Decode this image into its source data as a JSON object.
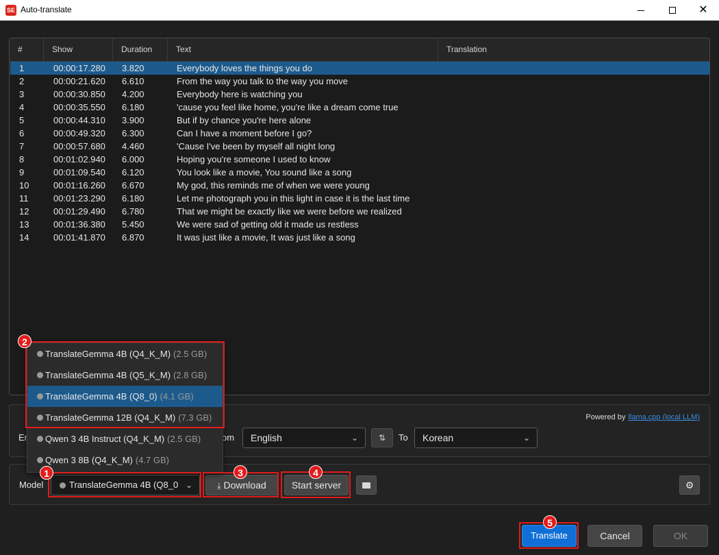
{
  "window": {
    "icon_text": "SE",
    "title": "Auto-translate",
    "minimize": "",
    "maximize": "",
    "close": "✕"
  },
  "grid": {
    "columns": [
      "#",
      "Show",
      "Duration",
      "Text",
      "Translation"
    ],
    "rows": [
      {
        "num": "1",
        "show": "00:00:17.280",
        "duration": "3.820",
        "text": "Everybody loves the things you do",
        "translation": ""
      },
      {
        "num": "2",
        "show": "00:00:21.620",
        "duration": "6.610",
        "text": "From the way you talk to the way you move",
        "translation": ""
      },
      {
        "num": "3",
        "show": "00:00:30.850",
        "duration": "4.200",
        "text": "Everybody here is watching you",
        "translation": ""
      },
      {
        "num": "4",
        "show": "00:00:35.550",
        "duration": "6.180",
        "text": "'cause you feel like home, you're like a dream come true",
        "translation": ""
      },
      {
        "num": "5",
        "show": "00:00:44.310",
        "duration": "3.900",
        "text": "But if by chance you're here alone",
        "translation": ""
      },
      {
        "num": "6",
        "show": "00:00:49.320",
        "duration": "6.300",
        "text": "Can I have a moment before I go?",
        "translation": ""
      },
      {
        "num": "7",
        "show": "00:00:57.680",
        "duration": "4.460",
        "text": "'Cause I've been by myself all night long",
        "translation": ""
      },
      {
        "num": "8",
        "show": "00:01:02.940",
        "duration": "6.000",
        "text": "Hoping you're someone I used to know",
        "translation": ""
      },
      {
        "num": "9",
        "show": "00:01:09.540",
        "duration": "6.120",
        "text": "You look like a movie, You sound like a song",
        "translation": ""
      },
      {
        "num": "10",
        "show": "00:01:16.260",
        "duration": "6.670",
        "text": "My god, this reminds me of when we were young",
        "translation": ""
      },
      {
        "num": "11",
        "show": "00:01:23.290",
        "duration": "6.180",
        "text": "Let me photograph you in this light in case it is the last time",
        "translation": ""
      },
      {
        "num": "12",
        "show": "00:01:29.490",
        "duration": "6.780",
        "text": "That we might be exactly like we were before we realized",
        "translation": ""
      },
      {
        "num": "13",
        "show": "00:01:36.380",
        "duration": "5.450",
        "text": "We were sad of getting old it made us restless",
        "translation": ""
      },
      {
        "num": "14",
        "show": "00:01:41.870",
        "duration": "6.870",
        "text": "It was just like a movie, It was just like a song",
        "translation": ""
      }
    ]
  },
  "language": {
    "powered_by": "Powered by",
    "powered_link": "llama.cpp (local LLM)",
    "engine_label_partial": "En",
    "from_label_partial": "om",
    "from_value": "English",
    "swap_glyph": "⇅",
    "to_label": "To",
    "to_value": "Korean"
  },
  "model": {
    "label": "Model",
    "selected": "TranslateGemma 4B (Q8_0",
    "download_label": "Download",
    "download_icon": "⤓",
    "start_server_label": "Start server",
    "folder_icon": "▬",
    "settings_icon": "⚙"
  },
  "dropdown": {
    "items": [
      {
        "name": "TranslateGemma 4B (Q4_K_M)",
        "size": "(2.5 GB)"
      },
      {
        "name": "TranslateGemma 4B (Q5_K_M)",
        "size": "(2.8 GB)"
      },
      {
        "name": "TranslateGemma 4B (Q8_0)",
        "size": "(4.1 GB)"
      },
      {
        "name": "TranslateGemma 12B (Q4_K_M)",
        "size": "(7.3 GB)"
      },
      {
        "name": "Qwen 3 4B Instruct (Q4_K_M)",
        "size": "(2.5 GB)"
      },
      {
        "name": "Qwen 3 8B (Q4_K_M)",
        "size": "(4.7 GB)"
      }
    ]
  },
  "footer": {
    "translate": "Translate",
    "cancel": "Cancel",
    "ok": "OK"
  },
  "badges": [
    "1",
    "2",
    "3",
    "4",
    "5"
  ],
  "colors": {
    "accent": "#0f6fd6",
    "selection": "#1d5a8c",
    "highlight": "#e41b1b"
  }
}
